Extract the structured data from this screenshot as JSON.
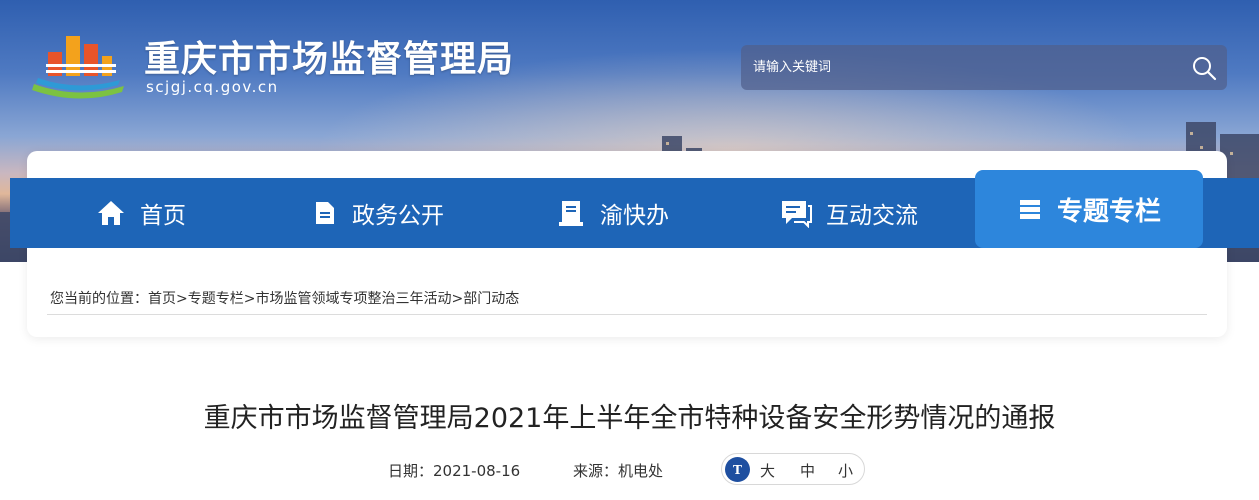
{
  "header": {
    "site_title": "重庆市市场监督管理局",
    "site_domain": "scjgj.cq.gov.cn",
    "logo_icon": "cq-scjgj-logo-icon"
  },
  "search": {
    "placeholder": "请输入关键词",
    "icon": "search-icon"
  },
  "nav": {
    "items": [
      {
        "label": "首页",
        "icon": "home-icon",
        "active": false
      },
      {
        "label": "政务公开",
        "icon": "document-icon",
        "active": false
      },
      {
        "label": "渝快办",
        "icon": "service-book-icon",
        "active": false
      },
      {
        "label": "互动交流",
        "icon": "chat-icon",
        "active": false
      },
      {
        "label": "专题专栏",
        "icon": "stack-icon",
        "active": true
      }
    ]
  },
  "breadcrumb": {
    "prefix": "您当前的位置：",
    "items": [
      "首页",
      "专题专栏",
      "市场监管领域专项整治三年活动",
      "部门动态"
    ],
    "separator": ">"
  },
  "article": {
    "title": "重庆市市场监督管理局2021年上半年全市特种设备安全形势情况的通报",
    "date_label": "日期：2021-08-16",
    "source_label": "来源：机电处",
    "font_size": {
      "icon_text": "T",
      "large": "大",
      "medium": "中",
      "small": "小"
    }
  },
  "colors": {
    "nav_bg": "#1e65b7",
    "nav_active_bg": "#2d86dc",
    "font_icon_bg": "#1e4fa0"
  }
}
